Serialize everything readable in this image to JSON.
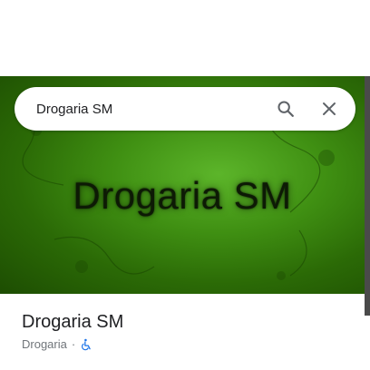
{
  "search": {
    "query": "Drogaria SM",
    "search_icon": "search-icon",
    "close_icon": "close-icon"
  },
  "hero": {
    "image_text": "Drogaria SM"
  },
  "place": {
    "name": "Drogaria SM",
    "category": "Drogaria",
    "separator": "·",
    "accessibility_icon": "wheelchair-icon",
    "accessibility_color": "#1a73e8"
  },
  "colors": {
    "hero_green": "#3f8f12",
    "text_primary": "#202124",
    "text_secondary": "#70757a",
    "icon_gray": "#5f6368"
  }
}
